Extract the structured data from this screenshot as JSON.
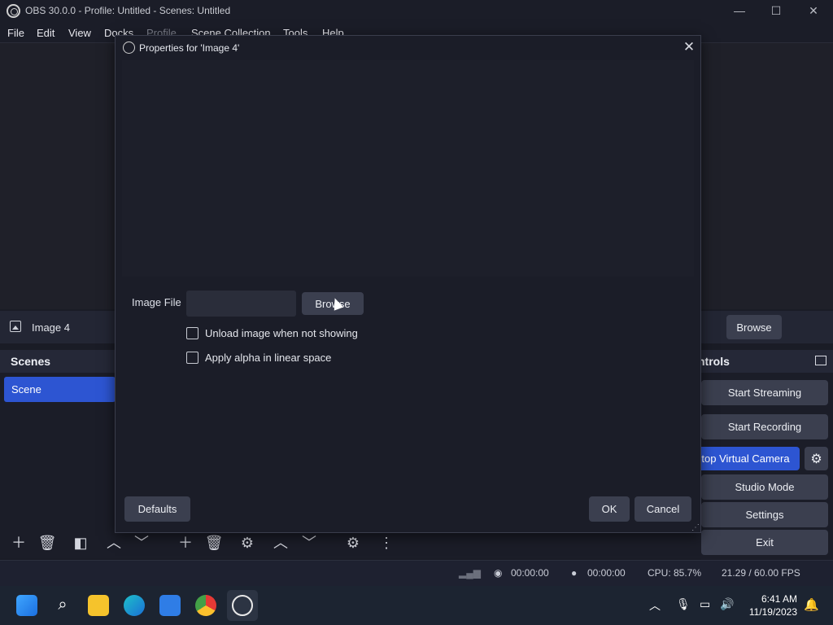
{
  "window": {
    "title": "OBS 30.0.0 - Profile: Untitled - Scenes: Untitled"
  },
  "menu": [
    "File",
    "Edit",
    "View",
    "Docks",
    "Profile",
    "Scene Collection",
    "Tools",
    "Help"
  ],
  "source_bar": {
    "source_name": "Image 4",
    "browse_label": "Browse"
  },
  "scenes": {
    "header": "Scenes",
    "items": [
      "Scene"
    ]
  },
  "controls": {
    "header": "ntrols",
    "buttons": [
      "Start Streaming",
      "Start Recording",
      "top Virtual Camera",
      "Studio Mode",
      "Settings",
      "Exit"
    ]
  },
  "status": {
    "stream_time": "00:00:00",
    "rec_time": "00:00:00",
    "cpu": "CPU: 85.7%",
    "fps": "21.29 / 60.00 FPS"
  },
  "taskbar": {
    "time": "6:41 AM",
    "date": "11/19/2023"
  },
  "dialog": {
    "title": "Properties for 'Image 4'",
    "image_file_label": "Image File",
    "image_file_value": "",
    "browse_label": "Browse",
    "unload_label": "Unload image when not showing",
    "alpha_label": "Apply alpha in linear space",
    "defaults_label": "Defaults",
    "ok_label": "OK",
    "cancel_label": "Cancel"
  },
  "colors": {
    "accent": "#2d55d2",
    "background": "#1b1d28",
    "button": "#3b3f4f"
  }
}
